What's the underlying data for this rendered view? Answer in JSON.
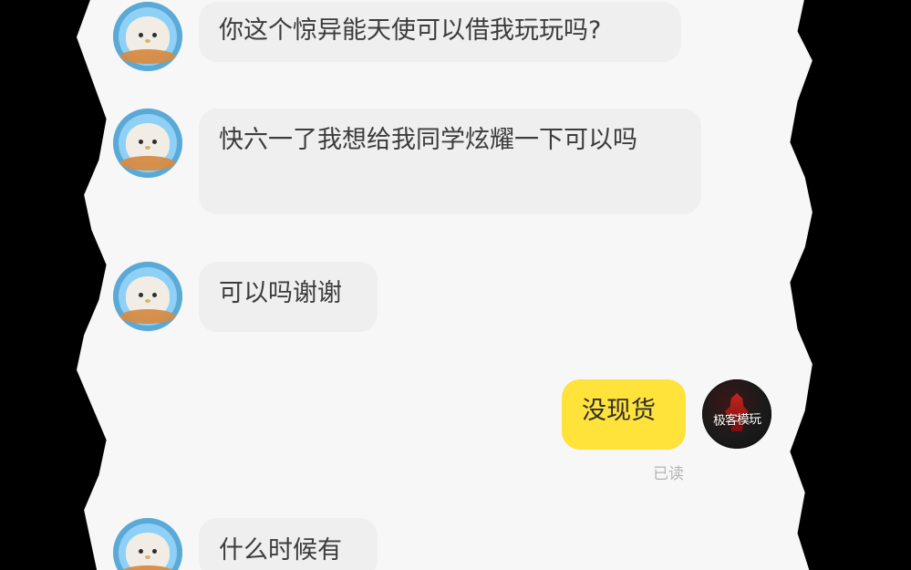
{
  "chat": {
    "messages": [
      {
        "text": "你这个惊异能天使可以借我玩玩吗?"
      },
      {
        "text": "快六一了我想给我同学炫耀一下可以吗"
      },
      {
        "text": "可以吗谢谢"
      },
      {
        "text": "没现货",
        "status": "已读"
      },
      {
        "text": "什么时候有"
      }
    ],
    "avatars": {
      "seller_tag": "极客模玩"
    }
  }
}
